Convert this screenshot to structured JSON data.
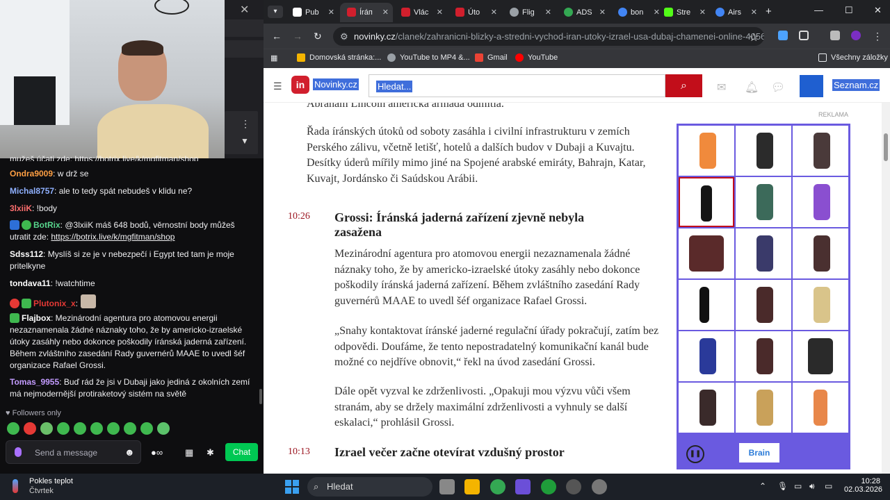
{
  "chat": {
    "clipped_line": "mužeš účati zde: https://botrix.live/k/mgfitman/shop",
    "messages": [
      {
        "user": "Ondra9009",
        "color": "#ff9f43",
        "text": ": w drž se"
      },
      {
        "user": "Michal8757",
        "color": "#8fb0ff",
        "text": ": ale to tedy spát nebudeš v klidu ne?"
      },
      {
        "user": "3lxiiK",
        "color": "#ff6f6f",
        "text": ": !body"
      },
      {
        "user": "BotRix",
        "color": "#58d68d",
        "text": ": @3lxiiK máš 648 bodů, věrnostní body můžeš utratit zde: ",
        "link": "https://botrix.live/k/mgfitman/shop"
      },
      {
        "user": "Sdss112",
        "color": "#ffffff",
        "text": ": Myslíš si ze je v nebezpečí i Egypt ted tam je moje pritelkyne"
      },
      {
        "user": "tondava11",
        "color": "#ffffff",
        "text": ": !watchtime"
      },
      {
        "user": "Plutonix_x",
        "color": "#e53935",
        "text": ":"
      },
      {
        "user": "Flajbox",
        "color": "#ffffff",
        "text": ": Mezinárodní agentura pro atomovou energii nezaznamenala žádné náznaky toho, že by americko-izraelské útoky zasáhly nebo dokonce poškodily íránská jaderná zařízení. Během zvláštního zasedání Rady guvernérů MAAE to uvedl šéf organizace Rafael Grossi."
      },
      {
        "user": "Tomas_9955",
        "color": "#c39bff",
        "text": ": Buď rád že jsi v Dubaji jako jediná z okolních zemí má nejmodernější protiraketový sistém na světě"
      }
    ],
    "followers_only": "Followers only",
    "input_placeholder": "Send a message",
    "chat_button": "Chat"
  },
  "browser": {
    "tabs": [
      {
        "label": "Pub",
        "color": "#ffffff"
      },
      {
        "label": "Íráп",
        "color": "#d11f2d"
      },
      {
        "label": "Vlác",
        "color": "#d11f2d"
      },
      {
        "label": "Úto",
        "color": "#d11f2d"
      },
      {
        "label": "Flig",
        "color": "#9aa0a6"
      },
      {
        "label": "ADS",
        "color": "#34a853"
      },
      {
        "label": "bon",
        "color": "#4285f4"
      },
      {
        "label": "Stre",
        "color": "#53fc18"
      },
      {
        "label": "Airs",
        "color": "#4285f4"
      }
    ],
    "url_host": "novinky.cz",
    "url_path": "/clanek/zahranicni-blizky-a-stredni-vychod-iran-utoky-izrael-usa-dubaj-chamenei-online-40564...",
    "bookmarks": [
      "Domovská stránka:...",
      "YouTube to MP4 &...",
      "Gmail",
      "YouTube"
    ],
    "all_bookmarks": "Všechny záložky"
  },
  "site": {
    "logo_letters": "in",
    "logo_text": "Novinky.cz",
    "search_placeholder": "Hledat...",
    "seznam": "Seznam.cz",
    "ad_label": "REKLAMA",
    "ad_brand": "Brain"
  },
  "article": {
    "cut_line": "Abraham Lincoln americká armáda odmítla.",
    "para1": "Řada íránských útoků od soboty zasáhla i civilní infrastrukturu v zemích Perského zálivu, včetně letišť, hotelů a dalších budov v Dubaji a Kuvajtu. Desítky úderů mířily mimo jiné na Spojené arabské emiráty, Bahrajn, Katar, Kuvajt, Jordánsko či Saúdskou Arábii.",
    "time1": "10:26",
    "heading1": "Grossi: Íránská jaderná zařízení zjevně nebyla zasažena",
    "para2": "Mezinárodní agentura pro atomovou energii nezaznamenala žádné náznaky toho, že by americko-izraelské útoky zasáhly nebo dokonce poškodily íránská jaderná zařízení. Během zvláštního zasedání Rady guvernérů MAAE to uvedl šéf organizace Rafael Grossi.",
    "para3": "„Snahy kontaktovat íránské jaderné regulační úřady pokračují, zatím bez odpovědi. Doufáme, že tento nepostradatelný komunikační kanál bude možné co nejdříve obnovit,“ řekl na úvod zasedání Grossi.",
    "para4": "Dále opět vyzval ke zdrženlivosti. „Opakuji mou výzvu vůči všem stranám, aby se držely maximální zdrženlivosti a vyhnuly se další eskalaci,“ prohlásil Grossi.",
    "time2": "10:13",
    "heading2": "Izrael večer začne otevírat vzdušný prostor"
  },
  "taskbar": {
    "weather_title": "Pokles teplot",
    "weather_day": "Čtvrtek",
    "search": "Hledat",
    "time": "10:28",
    "date": "02.03.2026"
  }
}
